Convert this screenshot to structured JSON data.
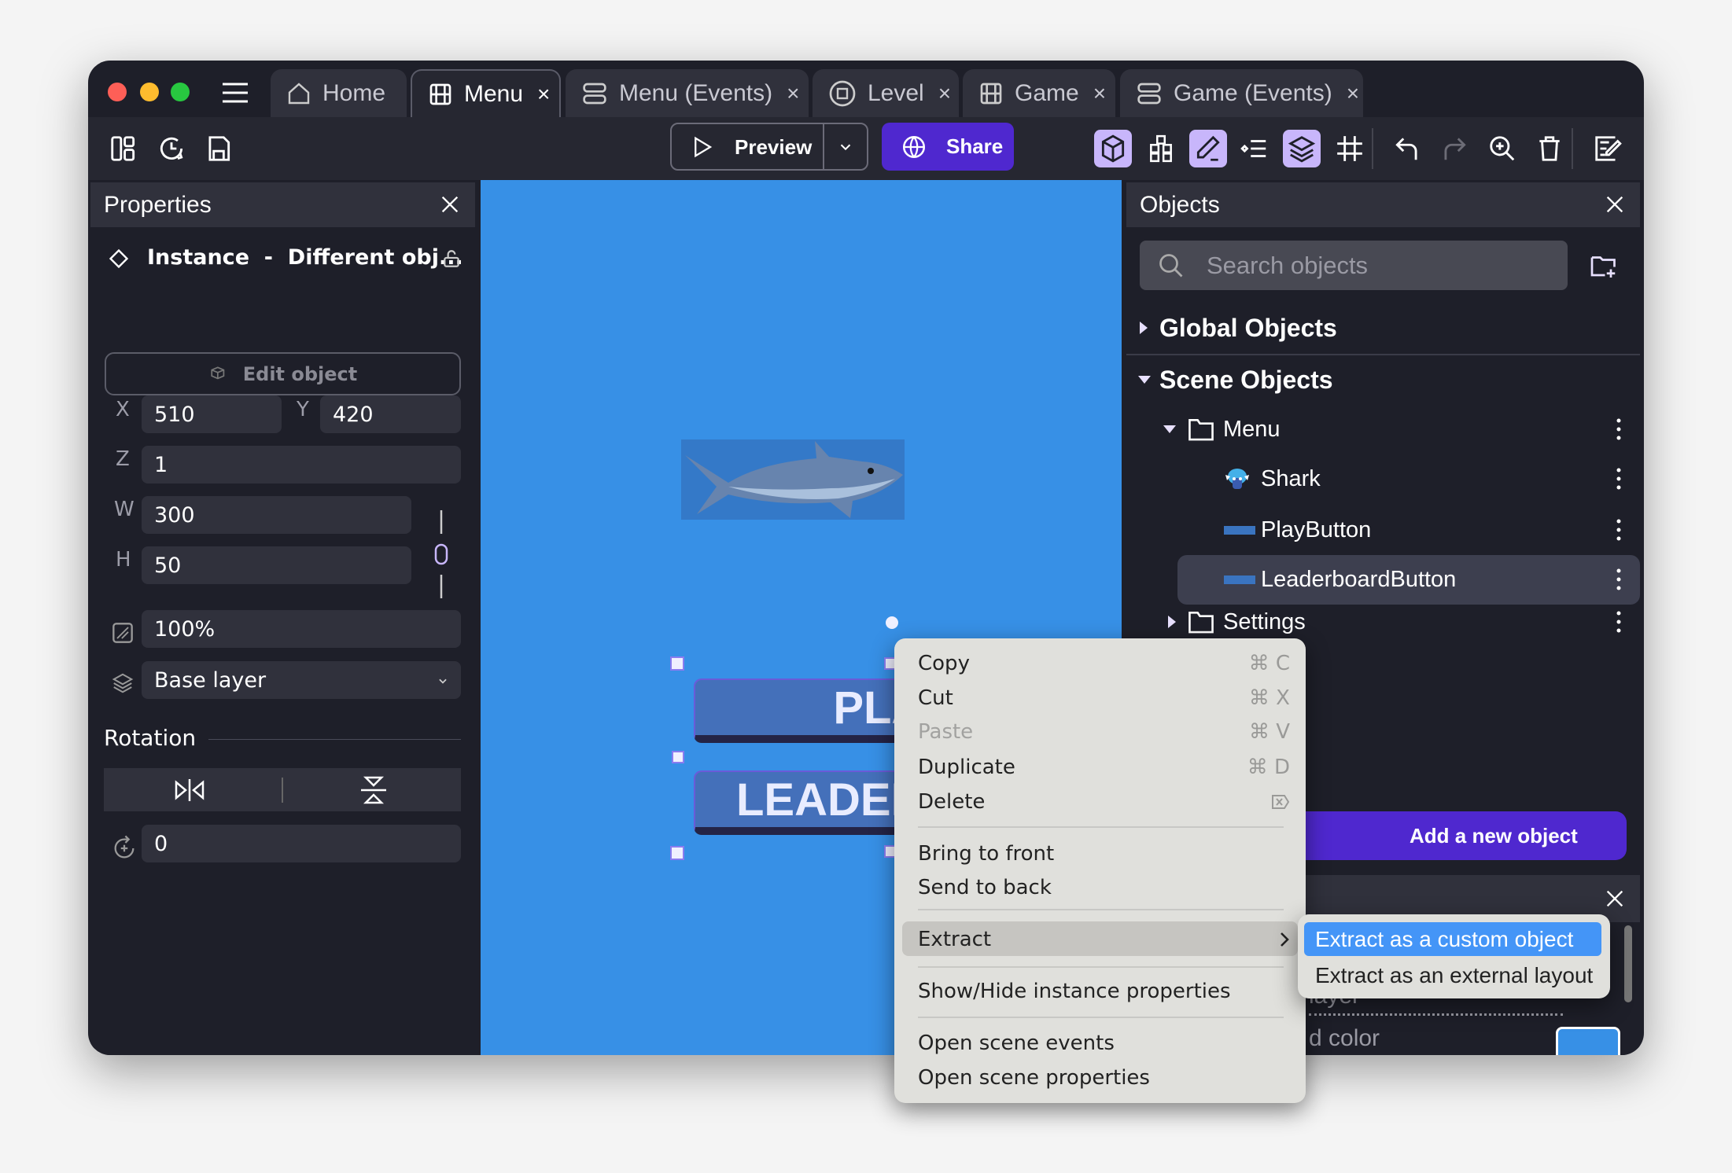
{
  "tabs": [
    {
      "label": "Home",
      "icon": "home-icon"
    },
    {
      "label": "Menu",
      "icon": "film-icon",
      "active": true
    },
    {
      "label": "Menu (Events)",
      "icon": "events-icon"
    },
    {
      "label": "Level",
      "icon": "level-icon"
    },
    {
      "label": "Game",
      "icon": "film-icon"
    },
    {
      "label": "Game (Events)",
      "icon": "events-icon"
    }
  ],
  "tab_close": "×",
  "toolbar": {
    "preview_label": "Preview",
    "share_label": "Share",
    "accent": "#4f28cf",
    "toggle_on_color": "#c8b6fb"
  },
  "properties": {
    "title": "Properties",
    "instance_label": "Instance  -  Different obj...",
    "edit_object_label": "Edit object",
    "x_label": "X",
    "x_value": "510",
    "y_label": "Y",
    "y_value": "420",
    "z_label": "Z",
    "z_value": "1",
    "w_label": "W",
    "w_value": "300",
    "h_label": "H",
    "h_value": "50",
    "opacity_value": "100%",
    "layer_value": "Base layer",
    "rotation_label": "Rotation",
    "angle_value": "0"
  },
  "canvas": {
    "background": "#3790e6",
    "play_text": "PLAY",
    "leaderboard_text": "LEADERBOARD"
  },
  "objects": {
    "title": "Objects",
    "search_placeholder": "Search objects",
    "global_label": "Global Objects",
    "scene_label": "Scene Objects",
    "folder_menu": "Menu",
    "items": [
      "Shark",
      "PlayButton",
      "LeaderboardButton"
    ],
    "folder_settings": "Settings",
    "add_label": "Add a new object",
    "layer_partial": "layer",
    "color_partial": "d color"
  },
  "context_menu": {
    "copy": "Copy",
    "copy_sc": "⌘ C",
    "cut": "Cut",
    "cut_sc": "⌘ X",
    "paste": "Paste",
    "paste_sc": "⌘ V",
    "duplicate": "Duplicate",
    "duplicate_sc": "⌘ D",
    "delete": "Delete",
    "bring_front": "Bring to front",
    "send_back": "Send to back",
    "extract": "Extract",
    "show_hide": "Show/Hide instance properties",
    "open_events": "Open scene events",
    "open_props": "Open scene properties"
  },
  "submenu": {
    "custom_object": "Extract as a custom object",
    "external_layout": "Extract as an external layout",
    "highlight": "#4495f7"
  }
}
